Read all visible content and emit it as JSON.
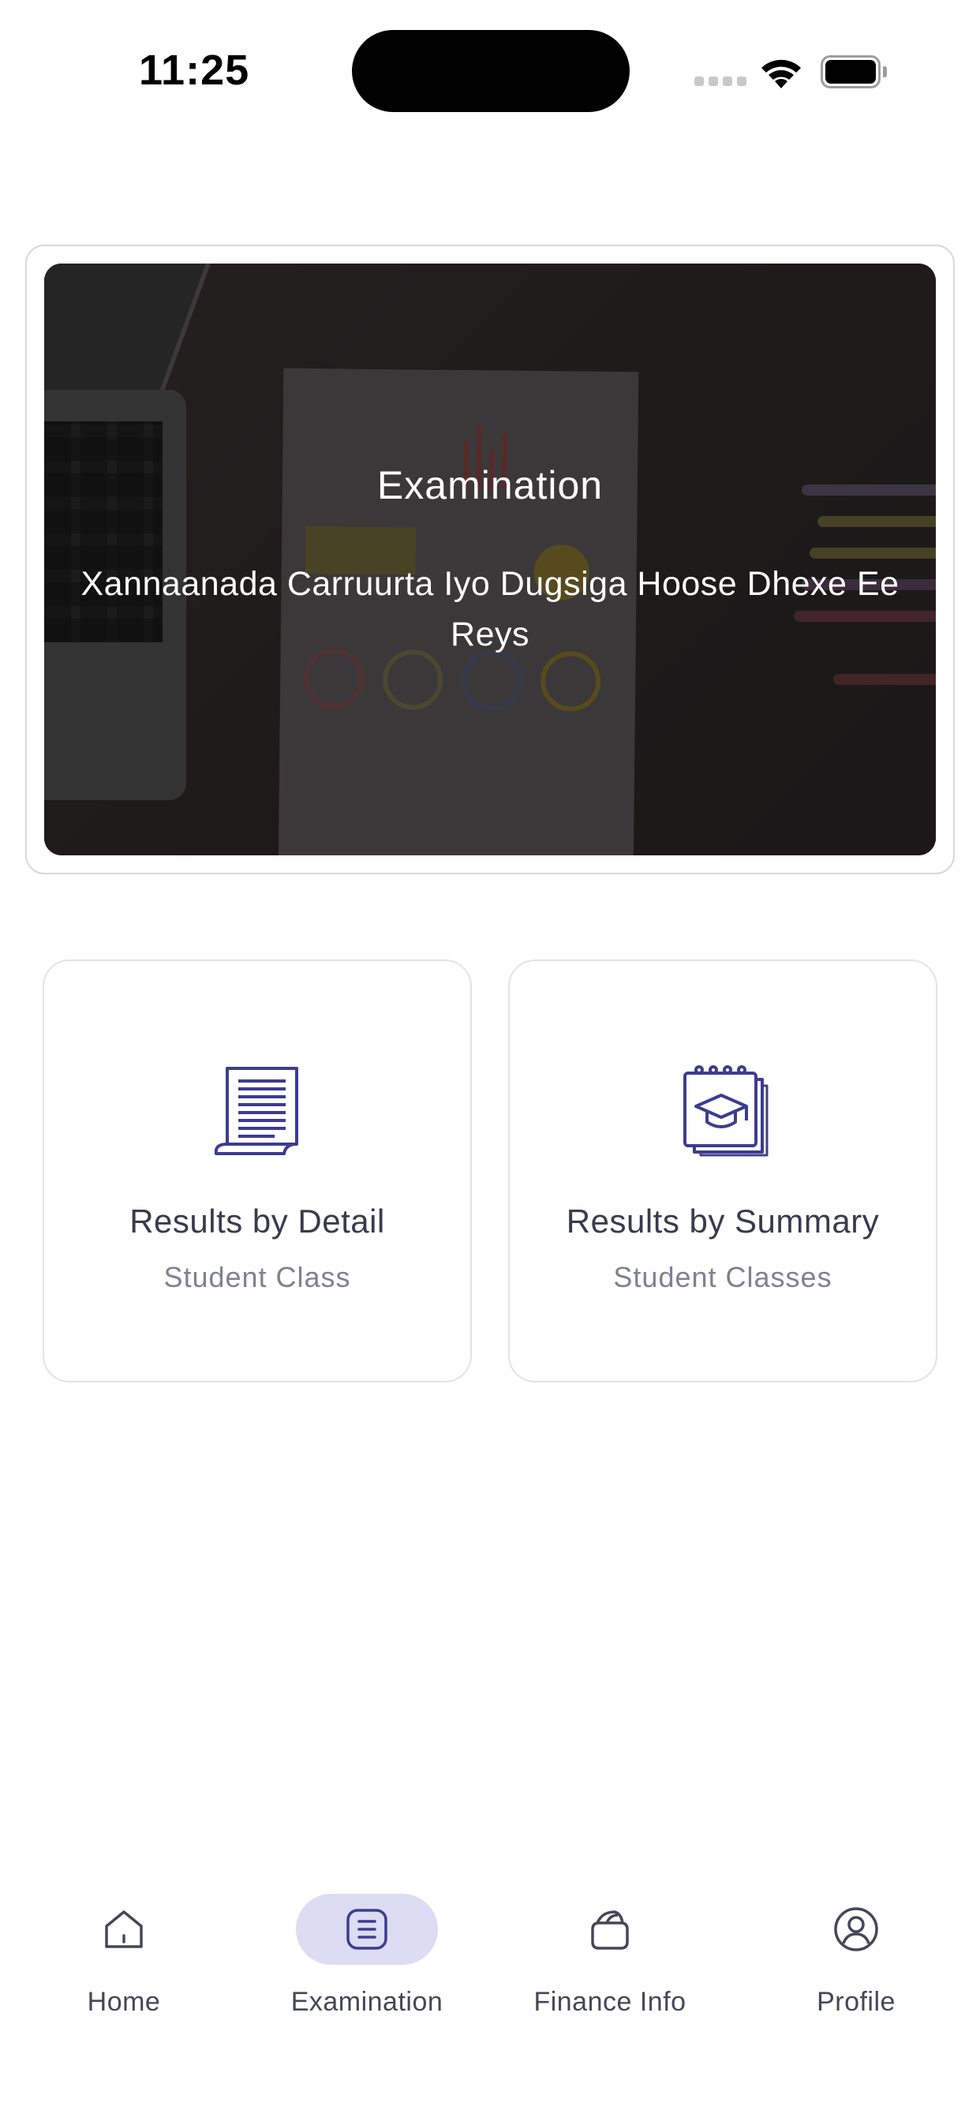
{
  "status_bar": {
    "time": "11:25"
  },
  "banner": {
    "title": "Examination",
    "subtitle": "Xannaanada Carruurta Iyo Dugsiga Hoose Dhexe Ee Reys"
  },
  "menu": {
    "cards": [
      {
        "title": "Results by Detail",
        "subtitle": "Student Class",
        "icon": "document-list-icon"
      },
      {
        "title": "Results by Summary",
        "subtitle": "Student Classes",
        "icon": "graduation-notebook-icon"
      }
    ]
  },
  "bottom_nav": {
    "items": [
      {
        "label": "Home",
        "icon": "home-icon",
        "active": false
      },
      {
        "label": "Examination",
        "icon": "examination-icon",
        "active": true
      },
      {
        "label": "Finance Info",
        "icon": "finance-icon",
        "active": false
      },
      {
        "label": "Profile",
        "icon": "profile-icon",
        "active": false
      }
    ]
  },
  "colors": {
    "accent": "#3d3d8f",
    "active_pill": "#dcdcf2",
    "text_primary": "#3a3a4e",
    "text_secondary": "#808092"
  }
}
